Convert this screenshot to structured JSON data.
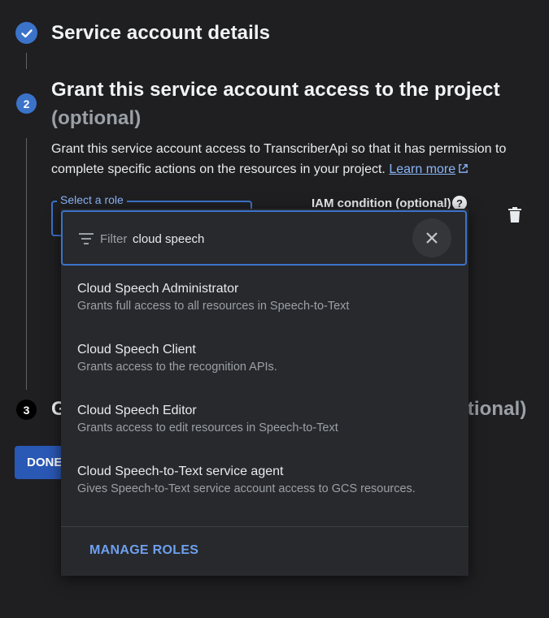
{
  "colors": {
    "accent": "#3b73c9",
    "link": "#8ab4f8",
    "background": "#1f1f21",
    "panel": "#28292c"
  },
  "steps": {
    "step1": {
      "title": "Service account details",
      "icon": "check-icon"
    },
    "step2": {
      "number": "2",
      "title": "Grant this service account access to the project",
      "optional": "(optional)",
      "description": "Grant this service account access to TranscriberApi so that it has permission to complete specific actions on the resources in your project.",
      "learn_more": "Learn more"
    },
    "step3": {
      "number": "3",
      "title_start": "G",
      "title_end": "ptional)"
    }
  },
  "role_field": {
    "label": "Select a role"
  },
  "iam_condition": {
    "label": "IAM condition (optional)"
  },
  "done_button": {
    "label": "DONE"
  },
  "dropdown": {
    "filter_prefix": "Filter",
    "filter_value": "cloud speech",
    "options": [
      {
        "title": "Cloud Speech Administrator",
        "description": "Grants full access to all resources in Speech-to-Text"
      },
      {
        "title": "Cloud Speech Client",
        "description": "Grants access to the recognition APIs."
      },
      {
        "title": "Cloud Speech Editor",
        "description": "Grants access to edit resources in Speech-to-Text"
      },
      {
        "title": "Cloud Speech-to-Text service agent",
        "description": "Gives Speech-to-Text service account access to GCS resources."
      }
    ],
    "manage_roles": "MANAGE ROLES"
  }
}
